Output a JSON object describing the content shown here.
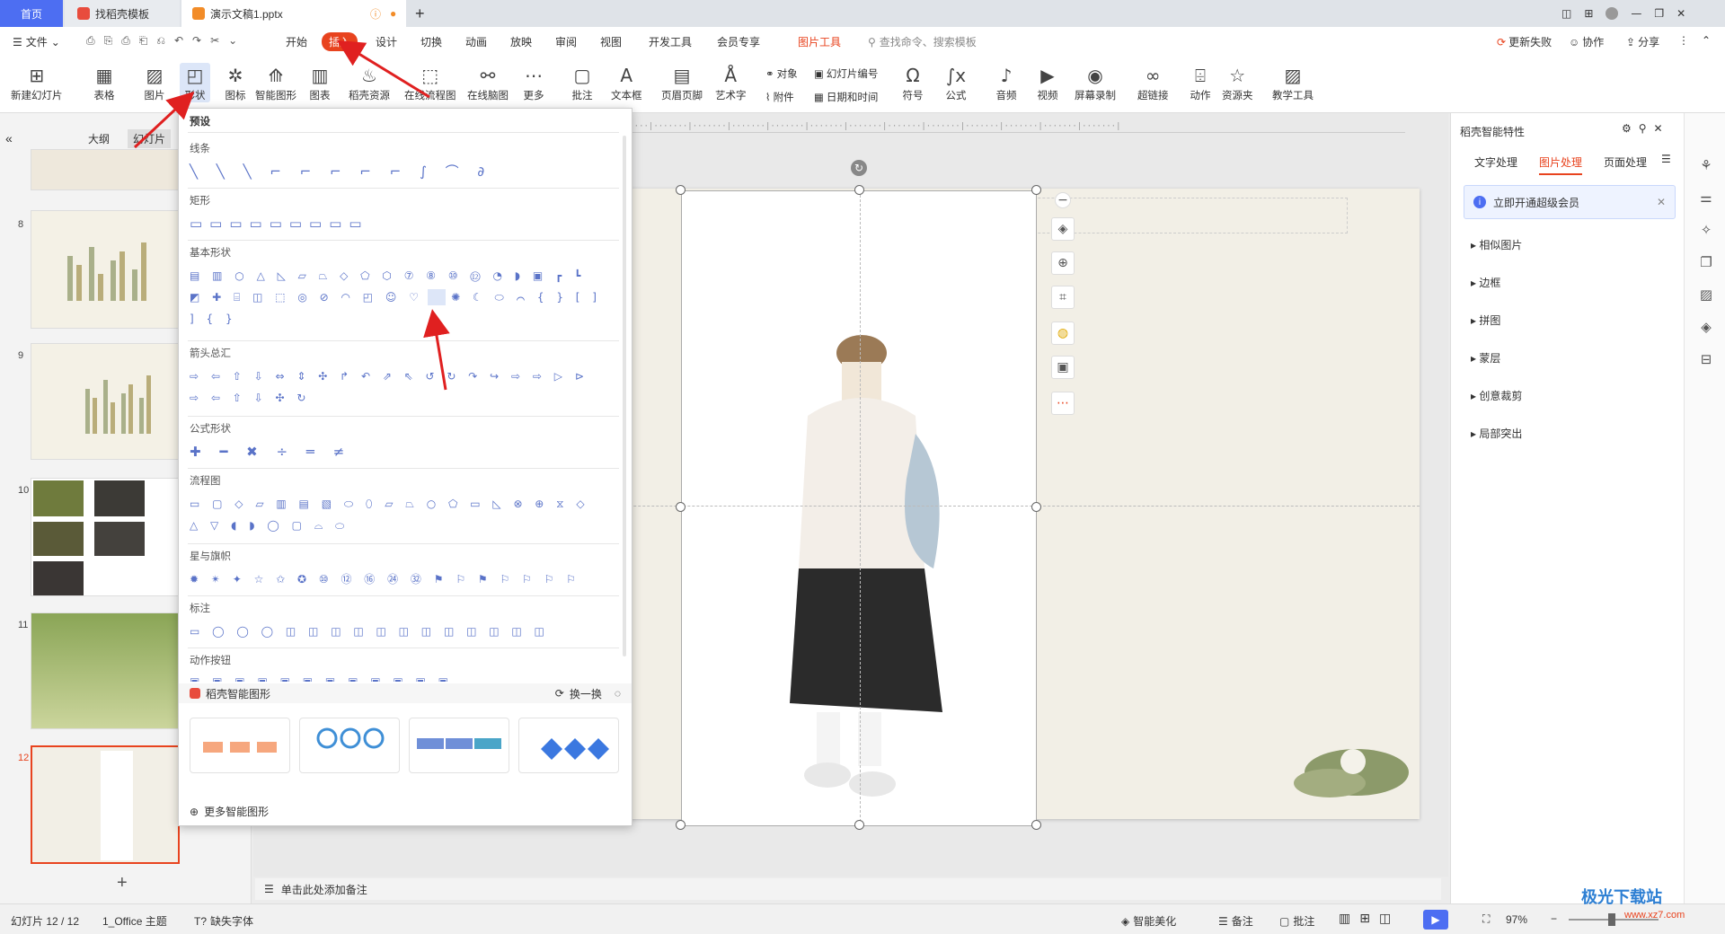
{
  "tabs": {
    "home": "首页",
    "template": "找稻壳模板",
    "doc": "演示文稿1.pptx"
  },
  "menu": {
    "file": "文件",
    "items": [
      "开始",
      "插入",
      "设计",
      "切换",
      "动画",
      "放映",
      "审阅",
      "视图",
      "开发工具",
      "会员专享",
      "图片工具"
    ],
    "search": "查找命令、搜索模板",
    "update_fail": "更新失败",
    "collab": "协作",
    "share": "分享"
  },
  "ribbon": {
    "new_slide": "新建幻灯片",
    "table": "表格",
    "picture": "图片",
    "shape": "形状",
    "icon": "图标",
    "smart": "智能图形",
    "chart": "图表",
    "docer": "稻壳资源",
    "flow": "在线流程图",
    "mind": "在线脑图",
    "more": "更多",
    "comment": "批注",
    "textbox": "文本框",
    "header": "页眉页脚",
    "art": "艺术字",
    "object": "对象",
    "slide_num": "幻灯片编号",
    "attach": "附件",
    "datetime": "日期和时间",
    "symbol": "符号",
    "formula": "公式",
    "audio": "音频",
    "video": "视频",
    "record": "屏幕录制",
    "hyperlink": "超链接",
    "action": "动作",
    "resource": "资源夹",
    "teach": "教学工具"
  },
  "left": {
    "outline": "大纲",
    "slides": "幻灯片",
    "nums": [
      "8",
      "9",
      "10",
      "11",
      "12"
    ]
  },
  "dropdown": {
    "preset": "预设",
    "lines": "线条",
    "rect": "矩形",
    "basic": "基本形状",
    "arrows": "箭头总汇",
    "formula": "公式形状",
    "flow": "流程图",
    "stars": "星与旗帜",
    "callout": "标注",
    "action": "动作按钮",
    "smart_title": "稻壳智能图形",
    "swap": "换一换",
    "more_smart": "更多智能图形"
  },
  "shapes": {
    "lines": "╲ ╲ ╲ ⌐ ⌐ ⌐ ⌐ ⌐ ∫ ⌒ ∂",
    "rect": "▭▭▭▭▭▭▭▭▭",
    "basic1": "▤ ▥ ○ △ ◺ ▱ ⏢ ◇ ⬠ ⬡ ⑦ ⑧ ⑩ ⑫ ◔ ◗ ▣ ┏ ┗",
    "basic2": "◩ ✚ ⌸ ◫ ⬚ ◎ ⊘ ◠ ◰ ☺ ♡ ⚡ ✺ ☾ ⬭ ⌒ { } [ ]",
    "basic3": "] { }",
    "arr1": "⇨ ⇦ ⇧ ⇩ ⇔ ⇕ ✣ ↱ ↶ ⇗ ⇖ ↺ ↻ ↷ ↪ ⇨ ⇨ ▷ ⊳",
    "arr2": "⇨ ⇦ ⇧ ⇩ ✣ ↻",
    "formula": "✚ ━ ✖ ÷ ═ ≠",
    "flow1": "▭ ▢ ◇ ▱ ▥ ▤ ▧ ⬭ ⬯ ▱ ⏢ ○ ⬠ ▭ ◺ ⊗ ⊕ ⧖ ◇",
    "flow2": "△ ▽ ◖ ◗ ◯ ▢ ⌓ ⬭",
    "stars": "✹ ✴ ✦ ☆ ✩ ✪ ⑩ ⑫ ⑯ ㉔ ㉜ ⚑ ⚐ ⚑ ⚐ ⚐ ⚐ ⚐",
    "callout": "▭ ◯ ◯ ◯ ◫ ◫ ◫ ◫ ◫ ◫ ◫ ◫ ◫ ◫ ◫ ◫",
    "actionbtn": "▣ ▣ ▣ ▣ ▣ ▣ ▣ ▣ ▣ ▣ ▣ ▣"
  },
  "notes": "单击此处添加备注",
  "status": {
    "slide": "幻灯片 12 / 12",
    "theme": "1_Office 主题",
    "font": "缺失字体",
    "beautify": "智能美化",
    "notes": "备注",
    "comment": "批注",
    "zoom": "97%"
  },
  "right": {
    "title": "稻壳智能特性",
    "tabs": [
      "文字处理",
      "图片处理",
      "页面处理"
    ],
    "vip": "立即开通超级会员",
    "items": [
      "相似图片",
      "边框",
      "拼图",
      "蒙层",
      "创意裁剪",
      "局部突出"
    ]
  },
  "watermark": {
    "site": "极光下载站",
    "url": "www.xz7.com"
  },
  "colors": {
    "accent": "#e8431e",
    "blue": "#4d6ef2"
  }
}
